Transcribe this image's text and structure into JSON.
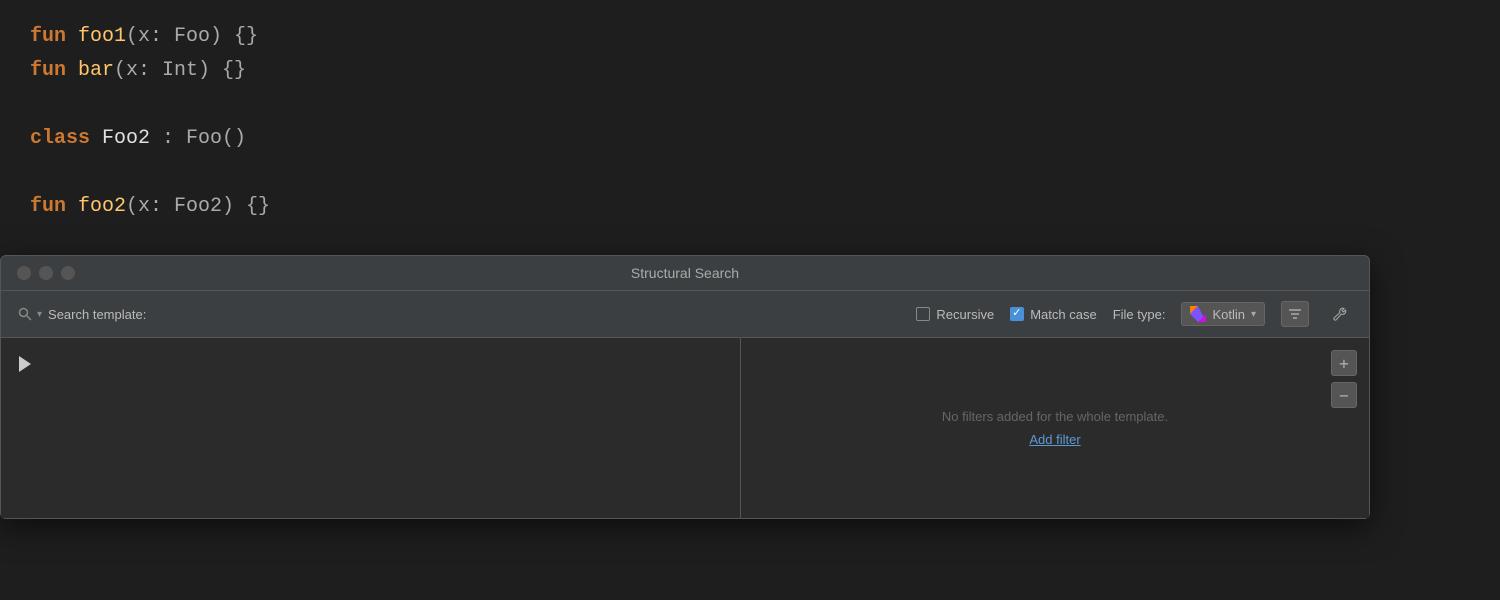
{
  "editor": {
    "lines": [
      {
        "id": 1,
        "parts": [
          {
            "text": "fun ",
            "cls": "kw-fun"
          },
          {
            "text": "foo1",
            "cls": "fn-name"
          },
          {
            "text": "(x: Foo) {}",
            "cls": "text-normal"
          }
        ]
      },
      {
        "id": 2,
        "parts": [
          {
            "text": "fun ",
            "cls": "kw-fun"
          },
          {
            "text": "bar",
            "cls": "fn-name"
          },
          {
            "text": "(x: Int) {}",
            "cls": "text-normal"
          }
        ]
      },
      {
        "id": 3,
        "parts": []
      },
      {
        "id": 4,
        "parts": [
          {
            "text": "class ",
            "cls": "kw-class"
          },
          {
            "text": "Foo2",
            "cls": "text-white"
          },
          {
            "text": " : Foo()",
            "cls": "text-normal"
          }
        ]
      },
      {
        "id": 5,
        "parts": []
      },
      {
        "id": 6,
        "parts": [
          {
            "text": "fun ",
            "cls": "kw-fun"
          },
          {
            "text": "foo2",
            "cls": "fn-name"
          },
          {
            "text": "(x: Foo2) {}",
            "cls": "text-normal"
          }
        ]
      }
    ]
  },
  "dialog": {
    "title": "Structural Search",
    "toolbar": {
      "search_template_label": "Search template:",
      "recursive_label": "Recursive",
      "recursive_checked": false,
      "match_case_label": "Match case",
      "match_case_checked": true,
      "file_type_label": "File type:",
      "file_type_value": "Kotlin",
      "filter_btn_label": "▼",
      "wrench_btn_label": "🔧"
    },
    "filters": {
      "placeholder": "No filters added for the whole template.",
      "add_filter_label": "Add filter"
    },
    "side_buttons": {
      "add_label": "+",
      "remove_label": "−"
    }
  }
}
